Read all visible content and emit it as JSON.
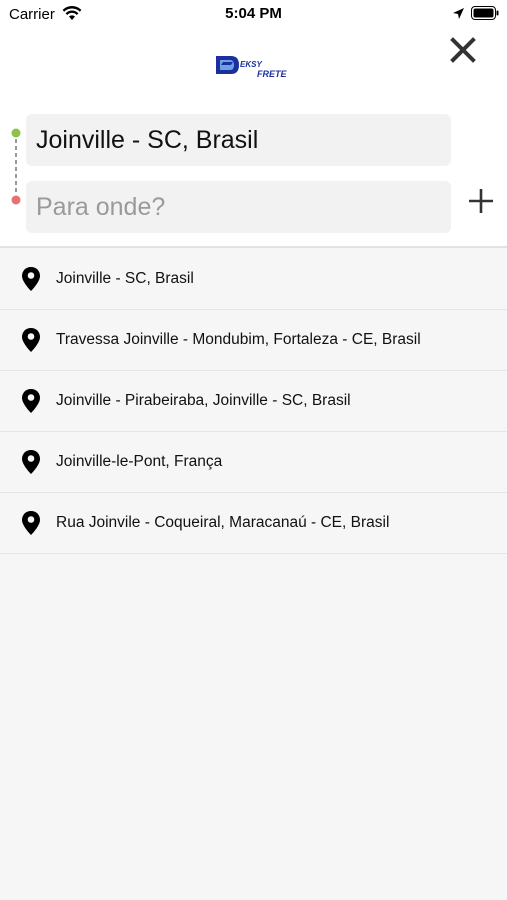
{
  "status_bar": {
    "carrier": "Carrier",
    "time": "5:04 PM"
  },
  "header": {
    "logo_text": "EKSY FRETE",
    "close_icon": "close-icon",
    "origin_value": "Joinville - SC, Brasil",
    "destination_placeholder": "Para onde?",
    "destination_value": "",
    "add_icon": "plus-icon",
    "origin_dot_color": "#8bc34a",
    "destination_dot_color": "#e57373"
  },
  "results": [
    {
      "label": "Joinville - SC, Brasil",
      "icon": "map-pin-icon"
    },
    {
      "label": "Travessa Joinville - Mondubim, Fortaleza - CE, Brasil",
      "icon": "map-pin-icon"
    },
    {
      "label": "Joinville - Pirabeiraba, Joinville - SC, Brasil",
      "icon": "map-pin-icon"
    },
    {
      "label": "Joinville-le-Pont, França",
      "icon": "map-pin-icon"
    },
    {
      "label": "Rua Joinvile - Coqueiral, Maracanaú - CE, Brasil",
      "icon": "map-pin-icon"
    }
  ]
}
